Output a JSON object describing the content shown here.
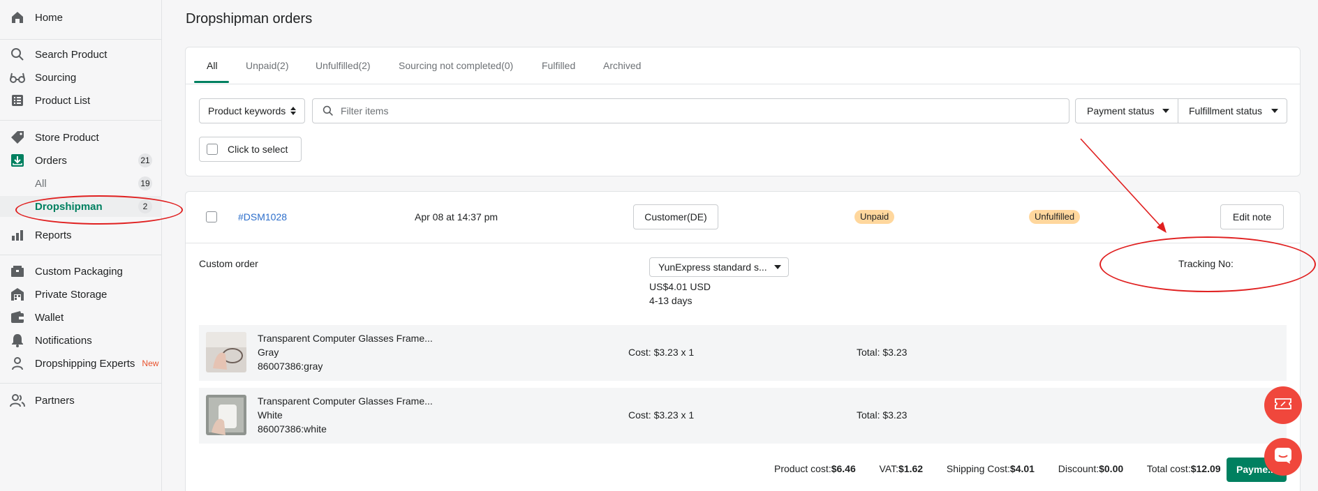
{
  "sidebar": {
    "items": [
      {
        "label": "Home",
        "icon": "home-icon"
      },
      {
        "label": "Search Product",
        "icon": "search-icon"
      },
      {
        "label": "Sourcing",
        "icon": "glasses-icon"
      },
      {
        "label": "Product List",
        "icon": "list-icon"
      },
      {
        "label": "Store Product",
        "icon": "tag-icon"
      },
      {
        "label": "Orders",
        "icon": "download-box-icon",
        "count": "21"
      },
      {
        "label": "All",
        "count": "19"
      },
      {
        "label": "Dropshipman",
        "count": "2"
      },
      {
        "label": "Reports",
        "icon": "bar-chart-icon"
      },
      {
        "label": "Custom Packaging",
        "icon": "package-icon"
      },
      {
        "label": "Private Storage",
        "icon": "storage-icon"
      },
      {
        "label": "Wallet",
        "icon": "wallet-icon"
      },
      {
        "label": "Notifications",
        "icon": "bell-icon"
      },
      {
        "label": "Dropshipping Experts",
        "icon": "expert-icon",
        "tag": "New"
      },
      {
        "label": "Partners",
        "icon": "partners-icon"
      }
    ]
  },
  "page": {
    "title": "Dropshipman orders"
  },
  "tabs": [
    "All",
    "Unpaid(2)",
    "Unfulfilled(2)",
    "Sourcing not completed(0)",
    "Fulfilled",
    "Archived"
  ],
  "filters": {
    "keyword_select": "Product keywords",
    "search_placeholder": "Filter items",
    "payment_status": "Payment status",
    "fulfillment_status": "Fulfillment status",
    "select_label": "Click to select"
  },
  "order": {
    "id": "#DSM1028",
    "date": "Apr 08 at 14:37 pm",
    "customer": "Customer(DE)",
    "payment_badge": "Unpaid",
    "fulfillment_badge": "Unfulfilled",
    "edit_note": "Edit note",
    "type": "Custom order",
    "shipping_method": "YunExpress standard s...",
    "shipping_price": "US$4.01 USD",
    "shipping_days": "4-13 days",
    "tracking_label": "Tracking No:",
    "items": [
      {
        "title": "Transparent Computer Glasses Frame...",
        "variant": "Gray",
        "sku": "86007386:gray",
        "cost": "Cost: $3.23 x 1",
        "total": "Total: $3.23"
      },
      {
        "title": "Transparent Computer Glasses Frame...",
        "variant": "White",
        "sku": "86007386:white",
        "cost": "Cost: $3.23 x 1",
        "total": "Total: $3.23"
      }
    ],
    "summary": {
      "product_cost_label": "Product cost:",
      "product_cost": "$6.46",
      "vat_label": "VAT:",
      "vat": "$1.62",
      "shipping_label": "Shipping Cost:",
      "shipping": "$4.01",
      "discount_label": "Discount:",
      "discount": "$0.00",
      "total_label": "Total cost:",
      "total": "$12.09",
      "pay_button": "Payme..."
    }
  },
  "colors": {
    "accent": "#008060",
    "badge": "#ffd79d",
    "annotation": "#e02020",
    "fab": "#f0473c"
  }
}
